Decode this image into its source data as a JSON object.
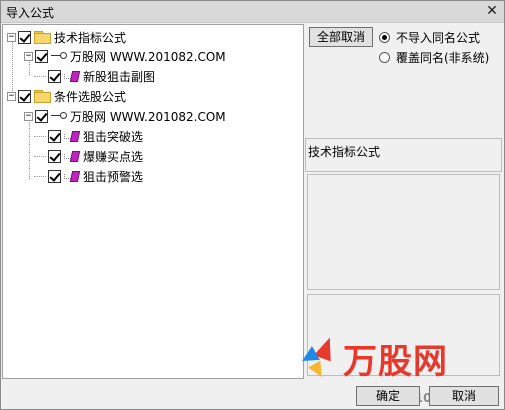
{
  "window": {
    "title": "导入公式",
    "close_glyph": "✕"
  },
  "tree": {
    "nodes": [
      {
        "label": "技术指标公式",
        "type": "folder",
        "checked": true,
        "expander": "−"
      },
      {
        "label": "万股网 WWW.201082.COM",
        "type": "source",
        "checked": true,
        "expander": "−"
      },
      {
        "label": "新股狙击副图",
        "type": "formula",
        "checked": true
      },
      {
        "label": "条件选股公式",
        "type": "folder",
        "checked": true,
        "expander": "−"
      },
      {
        "label": "万股网 WWW.201082.COM",
        "type": "source",
        "checked": true,
        "expander": "−"
      },
      {
        "label": "狙击突破选",
        "type": "formula",
        "checked": true
      },
      {
        "label": "爆赚买点选",
        "type": "formula",
        "checked": true
      },
      {
        "label": "狙击预警选",
        "type": "formula",
        "checked": true
      }
    ]
  },
  "options": {
    "cancel_all_label": "全部取消",
    "radio_no_import_same": "不导入同名公式",
    "radio_overwrite_same": "覆盖同名(非系统)",
    "selected": "no_import_same"
  },
  "info": {
    "type_label": "技术指标公式"
  },
  "footer": {
    "ok_label": "确定",
    "cancel_label": "取消"
  },
  "brand": {
    "name": "万股网",
    "url": "www.201082.com"
  },
  "icons": [
    "close-icon",
    "folder-icon",
    "key-icon",
    "formula-icon",
    "checkbox-icon",
    "radio-icon",
    "expand-icon"
  ],
  "colors": {
    "formula_accent": "#c021c0",
    "brand_red": "#e8372b",
    "folder_yellow": "#f7d66b"
  }
}
